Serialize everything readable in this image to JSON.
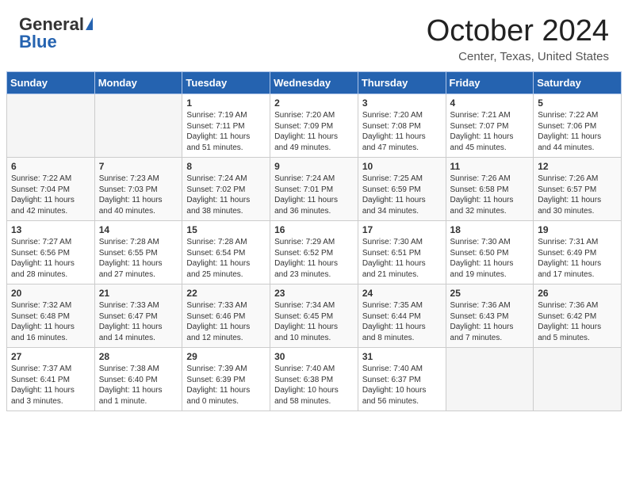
{
  "header": {
    "logo_general": "General",
    "logo_blue": "Blue",
    "month_title": "October 2024",
    "location": "Center, Texas, United States"
  },
  "days_of_week": [
    "Sunday",
    "Monday",
    "Tuesday",
    "Wednesday",
    "Thursday",
    "Friday",
    "Saturday"
  ],
  "weeks": [
    {
      "row_class": "row-even",
      "days": [
        {
          "num": "",
          "empty": true,
          "info": ""
        },
        {
          "num": "",
          "empty": true,
          "info": ""
        },
        {
          "num": "1",
          "empty": false,
          "info": "Sunrise: 7:19 AM\nSunset: 7:11 PM\nDaylight: 11 hours\nand 51 minutes."
        },
        {
          "num": "2",
          "empty": false,
          "info": "Sunrise: 7:20 AM\nSunset: 7:09 PM\nDaylight: 11 hours\nand 49 minutes."
        },
        {
          "num": "3",
          "empty": false,
          "info": "Sunrise: 7:20 AM\nSunset: 7:08 PM\nDaylight: 11 hours\nand 47 minutes."
        },
        {
          "num": "4",
          "empty": false,
          "info": "Sunrise: 7:21 AM\nSunset: 7:07 PM\nDaylight: 11 hours\nand 45 minutes."
        },
        {
          "num": "5",
          "empty": false,
          "info": "Sunrise: 7:22 AM\nSunset: 7:06 PM\nDaylight: 11 hours\nand 44 minutes."
        }
      ]
    },
    {
      "row_class": "row-odd",
      "days": [
        {
          "num": "6",
          "empty": false,
          "info": "Sunrise: 7:22 AM\nSunset: 7:04 PM\nDaylight: 11 hours\nand 42 minutes."
        },
        {
          "num": "7",
          "empty": false,
          "info": "Sunrise: 7:23 AM\nSunset: 7:03 PM\nDaylight: 11 hours\nand 40 minutes."
        },
        {
          "num": "8",
          "empty": false,
          "info": "Sunrise: 7:24 AM\nSunset: 7:02 PM\nDaylight: 11 hours\nand 38 minutes."
        },
        {
          "num": "9",
          "empty": false,
          "info": "Sunrise: 7:24 AM\nSunset: 7:01 PM\nDaylight: 11 hours\nand 36 minutes."
        },
        {
          "num": "10",
          "empty": false,
          "info": "Sunrise: 7:25 AM\nSunset: 6:59 PM\nDaylight: 11 hours\nand 34 minutes."
        },
        {
          "num": "11",
          "empty": false,
          "info": "Sunrise: 7:26 AM\nSunset: 6:58 PM\nDaylight: 11 hours\nand 32 minutes."
        },
        {
          "num": "12",
          "empty": false,
          "info": "Sunrise: 7:26 AM\nSunset: 6:57 PM\nDaylight: 11 hours\nand 30 minutes."
        }
      ]
    },
    {
      "row_class": "row-even",
      "days": [
        {
          "num": "13",
          "empty": false,
          "info": "Sunrise: 7:27 AM\nSunset: 6:56 PM\nDaylight: 11 hours\nand 28 minutes."
        },
        {
          "num": "14",
          "empty": false,
          "info": "Sunrise: 7:28 AM\nSunset: 6:55 PM\nDaylight: 11 hours\nand 27 minutes."
        },
        {
          "num": "15",
          "empty": false,
          "info": "Sunrise: 7:28 AM\nSunset: 6:54 PM\nDaylight: 11 hours\nand 25 minutes."
        },
        {
          "num": "16",
          "empty": false,
          "info": "Sunrise: 7:29 AM\nSunset: 6:52 PM\nDaylight: 11 hours\nand 23 minutes."
        },
        {
          "num": "17",
          "empty": false,
          "info": "Sunrise: 7:30 AM\nSunset: 6:51 PM\nDaylight: 11 hours\nand 21 minutes."
        },
        {
          "num": "18",
          "empty": false,
          "info": "Sunrise: 7:30 AM\nSunset: 6:50 PM\nDaylight: 11 hours\nand 19 minutes."
        },
        {
          "num": "19",
          "empty": false,
          "info": "Sunrise: 7:31 AM\nSunset: 6:49 PM\nDaylight: 11 hours\nand 17 minutes."
        }
      ]
    },
    {
      "row_class": "row-odd",
      "days": [
        {
          "num": "20",
          "empty": false,
          "info": "Sunrise: 7:32 AM\nSunset: 6:48 PM\nDaylight: 11 hours\nand 16 minutes."
        },
        {
          "num": "21",
          "empty": false,
          "info": "Sunrise: 7:33 AM\nSunset: 6:47 PM\nDaylight: 11 hours\nand 14 minutes."
        },
        {
          "num": "22",
          "empty": false,
          "info": "Sunrise: 7:33 AM\nSunset: 6:46 PM\nDaylight: 11 hours\nand 12 minutes."
        },
        {
          "num": "23",
          "empty": false,
          "info": "Sunrise: 7:34 AM\nSunset: 6:45 PM\nDaylight: 11 hours\nand 10 minutes."
        },
        {
          "num": "24",
          "empty": false,
          "info": "Sunrise: 7:35 AM\nSunset: 6:44 PM\nDaylight: 11 hours\nand 8 minutes."
        },
        {
          "num": "25",
          "empty": false,
          "info": "Sunrise: 7:36 AM\nSunset: 6:43 PM\nDaylight: 11 hours\nand 7 minutes."
        },
        {
          "num": "26",
          "empty": false,
          "info": "Sunrise: 7:36 AM\nSunset: 6:42 PM\nDaylight: 11 hours\nand 5 minutes."
        }
      ]
    },
    {
      "row_class": "row-even",
      "days": [
        {
          "num": "27",
          "empty": false,
          "info": "Sunrise: 7:37 AM\nSunset: 6:41 PM\nDaylight: 11 hours\nand 3 minutes."
        },
        {
          "num": "28",
          "empty": false,
          "info": "Sunrise: 7:38 AM\nSunset: 6:40 PM\nDaylight: 11 hours\nand 1 minute."
        },
        {
          "num": "29",
          "empty": false,
          "info": "Sunrise: 7:39 AM\nSunset: 6:39 PM\nDaylight: 11 hours\nand 0 minutes."
        },
        {
          "num": "30",
          "empty": false,
          "info": "Sunrise: 7:40 AM\nSunset: 6:38 PM\nDaylight: 10 hours\nand 58 minutes."
        },
        {
          "num": "31",
          "empty": false,
          "info": "Sunrise: 7:40 AM\nSunset: 6:37 PM\nDaylight: 10 hours\nand 56 minutes."
        },
        {
          "num": "",
          "empty": true,
          "info": ""
        },
        {
          "num": "",
          "empty": true,
          "info": ""
        }
      ]
    }
  ]
}
